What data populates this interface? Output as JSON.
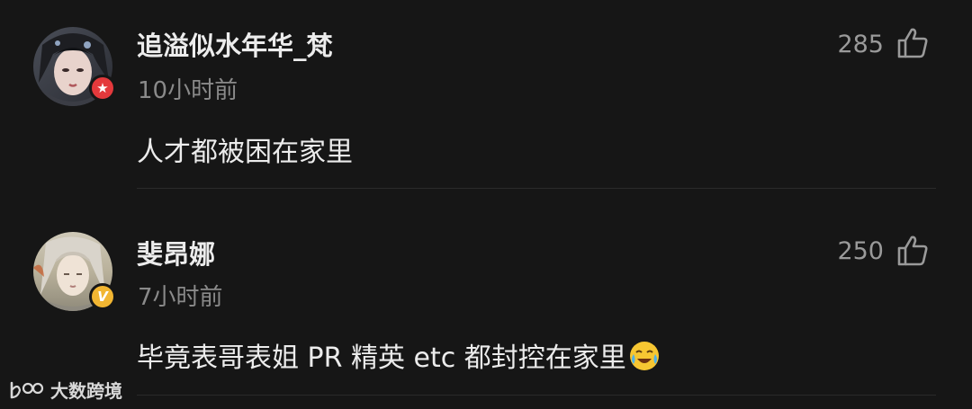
{
  "comments": [
    {
      "username": "追溢似水年华_梵",
      "timestamp": "10小时前",
      "content": "人才都被困在家里",
      "likes": "285",
      "badge": "star-badge",
      "badge_color": "#e4393c"
    },
    {
      "username": "斐昂娜",
      "timestamp": "7小时前",
      "content": "毕竟表哥表姐 PR 精英 etc 都封控在家里",
      "emoji": "crying-laughing-emoji",
      "likes": "250",
      "badge": "verified-v-badge",
      "badge_color": "#f2b632"
    }
  ],
  "watermark": {
    "text": "大数跨境"
  },
  "colors": {
    "background": "#161616",
    "text_primary": "#ececec",
    "text_secondary": "#8a8a8a",
    "like_icon": "#9a9a9a"
  }
}
